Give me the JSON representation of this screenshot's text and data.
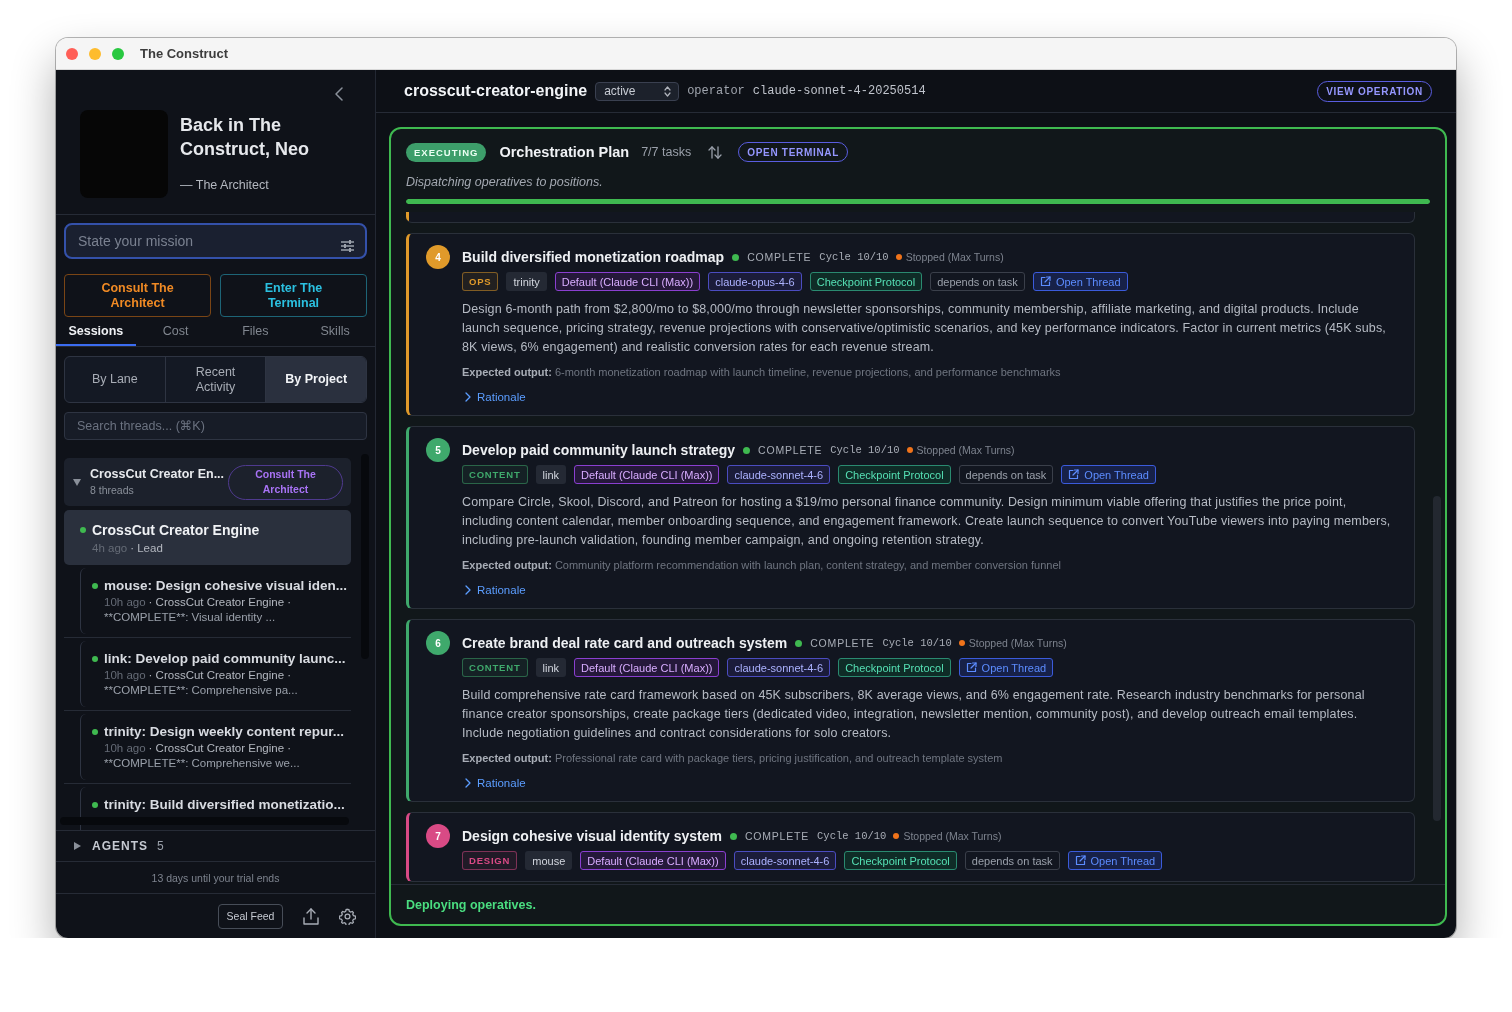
{
  "window": {
    "title": "The Construct"
  },
  "sidebar": {
    "hero": {
      "title": "Back in The Construct, Neo",
      "attribution": "— The Architect"
    },
    "mission": {
      "placeholder": "State your mission"
    },
    "actions": [
      {
        "label": "Consult The Architect",
        "kind": "architect"
      },
      {
        "label": "Enter The Terminal",
        "kind": "terminal"
      }
    ],
    "tabs": [
      {
        "label": "Sessions",
        "selected": true
      },
      {
        "label": "Cost",
        "selected": false
      },
      {
        "label": "Files",
        "selected": false
      },
      {
        "label": "Skills",
        "selected": false
      }
    ],
    "view_modes": [
      {
        "label": "By Lane",
        "selected": false
      },
      {
        "label": "Recent Activity",
        "selected": false
      },
      {
        "label": "By Project",
        "selected": true
      }
    ],
    "search": {
      "placeholder": "Search threads... (⌘K)"
    },
    "project": {
      "name": "CrossCut Creator En...",
      "count": "8 threads",
      "expanded": true,
      "action": "Consult The Architect",
      "threads": [
        {
          "title": "CrossCut Creator Engine",
          "time": "4h ago",
          "detail": "· Lead",
          "selected": true,
          "children": [
            {
              "title": "mouse: Design cohesive visual iden...",
              "time": "10h ago",
              "detail": "· CrossCut Creator Engine ·",
              "summary": "**COMPLETE**: Visual identity ...",
              "selected": false
            },
            {
              "title": "link: Develop paid community launc...",
              "time": "10h ago",
              "detail": "· CrossCut Creator Engine ·",
              "summary": "**COMPLETE**: Comprehensive pa...",
              "selected": false
            },
            {
              "title": "trinity: Design weekly content repur...",
              "time": "10h ago",
              "detail": "· CrossCut Creator Engine ·",
              "summary": "**COMPLETE**: Comprehensive we...",
              "selected": false
            },
            {
              "title": "trinity: Build diversified monetizatio...",
              "selected": false
            }
          ]
        }
      ]
    },
    "agents": {
      "label": "AGENTS",
      "count": "5",
      "expanded": false
    },
    "trial": "13 days until your trial ends",
    "footer": {
      "button": "Seal Feed"
    }
  },
  "operation": {
    "name": "crosscut-creator-engine",
    "status": "active",
    "operator_label": "operator",
    "operator_model": "claude-sonnet-4-20250514",
    "view_button": "VIEW OPERATION"
  },
  "plan": {
    "status": "EXECUTING",
    "title": "Orchestration Plan",
    "task_count": "7/7 tasks",
    "terminal_button": "OPEN TERMINAL",
    "subtitle": "Dispatching operatives to positions.",
    "level": 1,
    "tasks": [
      {
        "kind": "edge",
        "color": "#e09a2a"
      },
      {
        "kind": "card",
        "number": "4",
        "color": "#e09a2a",
        "title": "Build diversified monetization roadmap",
        "status": "COMPLETE",
        "cycle": "Cycle 10/10",
        "stop_reason": "Stopped (Max Turns)",
        "tags": [
          {
            "kind": "lane",
            "label": "OPS"
          },
          {
            "kind": "agent",
            "label": "trinity"
          },
          {
            "kind": "runtime",
            "label": "Default (Claude CLI (Max))"
          },
          {
            "kind": "model",
            "label": "claude-opus-4-6"
          },
          {
            "kind": "protocol",
            "label": "Checkpoint Protocol"
          },
          {
            "kind": "dependency",
            "label": "depends on task"
          },
          {
            "kind": "link",
            "label": "Open Thread"
          }
        ],
        "description": "Design 6-month path from $2,800/mo to $8,000/mo through newsletter sponsorships, community membership, affiliate marketing, and digital products. Include launch sequence, pricing strategy, revenue projections with conservative/optimistic scenarios, and key performance indicators. Factor in current metrics (45K subs, 8K views, 6% engagement) and realistic conversion rates for each revenue stream.",
        "expected": "**Expected output:** 6-month monetization roadmap with launch timeline, revenue projections, and performance benchmarks",
        "rationale": "Rationale"
      },
      {
        "kind": "card",
        "number": "5",
        "color": "#3fa96c",
        "title": "Develop paid community launch strategy",
        "status": "COMPLETE",
        "cycle": "Cycle 10/10",
        "stop_reason": "Stopped (Max Turns)",
        "tags": [
          {
            "kind": "lane",
            "label": "CONTENT"
          },
          {
            "kind": "agent",
            "label": "link"
          },
          {
            "kind": "runtime",
            "label": "Default (Claude CLI (Max))"
          },
          {
            "kind": "model",
            "label": "claude-sonnet-4-6"
          },
          {
            "kind": "protocol",
            "label": "Checkpoint Protocol"
          },
          {
            "kind": "dependency",
            "label": "depends on task"
          },
          {
            "kind": "link",
            "label": "Open Thread"
          }
        ],
        "description": "Compare Circle, Skool, Discord, and Patreon for hosting a $19/mo personal finance community. Design minimum viable offering that justifies the price point, including content calendar, member onboarding sequence, and engagement framework. Create launch sequence to convert YouTube viewers into paying members, including pre-launch validation, founding member campaign, and ongoing retention strategy.",
        "expected": "**Expected output:** Community platform recommendation with launch plan, content strategy, and member conversion funnel",
        "rationale": "Rationale"
      },
      {
        "kind": "card",
        "number": "6",
        "color": "#3fa96c",
        "title": "Create brand deal rate card and outreach system",
        "status": "COMPLETE",
        "cycle": "Cycle 10/10",
        "stop_reason": "Stopped (Max Turns)",
        "tags": [
          {
            "kind": "lane",
            "label": "CONTENT"
          },
          {
            "kind": "agent",
            "label": "link"
          },
          {
            "kind": "runtime",
            "label": "Default (Claude CLI (Max))"
          },
          {
            "kind": "model",
            "label": "claude-sonnet-4-6"
          },
          {
            "kind": "protocol",
            "label": "Checkpoint Protocol"
          },
          {
            "kind": "link",
            "label": "Open Thread"
          }
        ],
        "description": "Build comprehensive rate card framework based on 45K subscribers, 8K average views, and 6% engagement rate. Research industry benchmarks for personal finance creator sponsorships, create package tiers (dedicated video, integration, newsletter mention, community post), and develop outreach email templates. Include negotiation guidelines and contract considerations for solo creators.",
        "expected": "**Expected output:** Professional rate card with package tiers, pricing justification, and outreach template system",
        "rationale": "Rationale"
      },
      {
        "kind": "card",
        "number": "7",
        "color": "#d94a85",
        "title": "Design cohesive visual identity system",
        "status": "COMPLETE",
        "cycle": "Cycle 10/10",
        "stop_reason": "Stopped (Max Turns)",
        "tags": [
          {
            "kind": "lane",
            "label": "DESIGN"
          },
          {
            "kind": "agent",
            "label": "mouse"
          },
          {
            "kind": "runtime",
            "label": "Default (Claude CLI (Max))"
          },
          {
            "kind": "model",
            "label": "claude-sonnet-4-6"
          },
          {
            "kind": "protocol",
            "label": "Checkpoint Protocol"
          },
          {
            "kind": "dependency",
            "label": "depends on task"
          },
          {
            "kind": "link",
            "label": "Open Thread"
          }
        ]
      }
    ],
    "footer": "Deploying operatives."
  }
}
